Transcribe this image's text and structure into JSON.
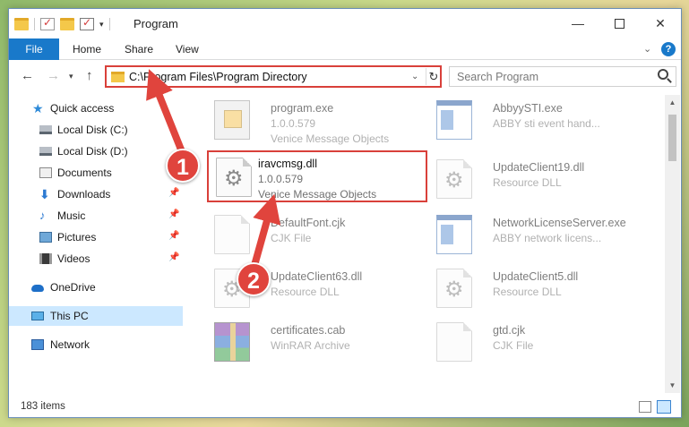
{
  "window": {
    "title": "Program",
    "controls": {
      "minimize": "—",
      "maximize": "",
      "close": "✕"
    }
  },
  "ribbon": {
    "tabs": [
      "File",
      "Home",
      "Share",
      "View"
    ],
    "help": "?"
  },
  "address_bar": {
    "path": "C:\\Program Files\\Program Directory"
  },
  "search": {
    "placeholder": "Search Program"
  },
  "nav_pane": {
    "items": [
      {
        "label": "Quick access",
        "icon": "star-icon"
      },
      {
        "label": "Local Disk (C:)",
        "icon": "drive-icon"
      },
      {
        "label": "Local Disk (D:)",
        "icon": "drive-icon"
      },
      {
        "label": "Documents",
        "icon": "documents-icon",
        "pinned": true
      },
      {
        "label": "Downloads",
        "icon": "download-arrow-icon",
        "pinned": true
      },
      {
        "label": "Music",
        "icon": "music-note-icon",
        "pinned": true
      },
      {
        "label": "Pictures",
        "icon": "pictures-icon",
        "pinned": true
      },
      {
        "label": "Videos",
        "icon": "film-strip-icon",
        "pinned": true
      },
      {
        "label": "OneDrive",
        "icon": "cloud-icon"
      },
      {
        "label": "This PC",
        "icon": "computer-icon",
        "selected": true
      },
      {
        "label": "Network",
        "icon": "network-icon"
      }
    ]
  },
  "files": [
    {
      "name": "program.exe",
      "line2": "1.0.0.579",
      "line3": "Venice Message Objects",
      "icon": "exe-icon"
    },
    {
      "name": "AbbyySTI.exe",
      "line2": "ABBY sti event hand...",
      "icon": "app-window-icon"
    },
    {
      "name": "iravcmsg.dll",
      "line2": "1.0.0.579",
      "line3": "Venice Message Objects",
      "icon": "gear-file-icon",
      "highlighted": true
    },
    {
      "name": "UpdateClient19.dll",
      "line2": "Resource DLL",
      "icon": "gear-file-icon"
    },
    {
      "name": "DefaultFont.cjk",
      "line2": "CJK File",
      "icon": "blank-file-icon"
    },
    {
      "name": "NetworkLicenseServer.exe",
      "line2": "ABBY network licens...",
      "icon": "app-window-icon"
    },
    {
      "name": "UpdateClient63.dll",
      "line2": "Resource DLL",
      "icon": "gear-file-icon"
    },
    {
      "name": "UpdateClient5.dll",
      "line2": "Resource DLL",
      "icon": "gear-file-icon"
    },
    {
      "name": "certificates.cab",
      "line2": "WinRAR Archive",
      "icon": "winrar-archive-icon"
    },
    {
      "name": "gtd.cjk",
      "line2": "CJK File",
      "icon": "blank-file-icon"
    }
  ],
  "status": {
    "item_count": "183 items"
  },
  "callouts": {
    "step1": "1",
    "step2": "2"
  },
  "colors": {
    "accent": "#1979ca",
    "highlight_red": "#d9403a",
    "selected_bg": "#cce8ff"
  }
}
